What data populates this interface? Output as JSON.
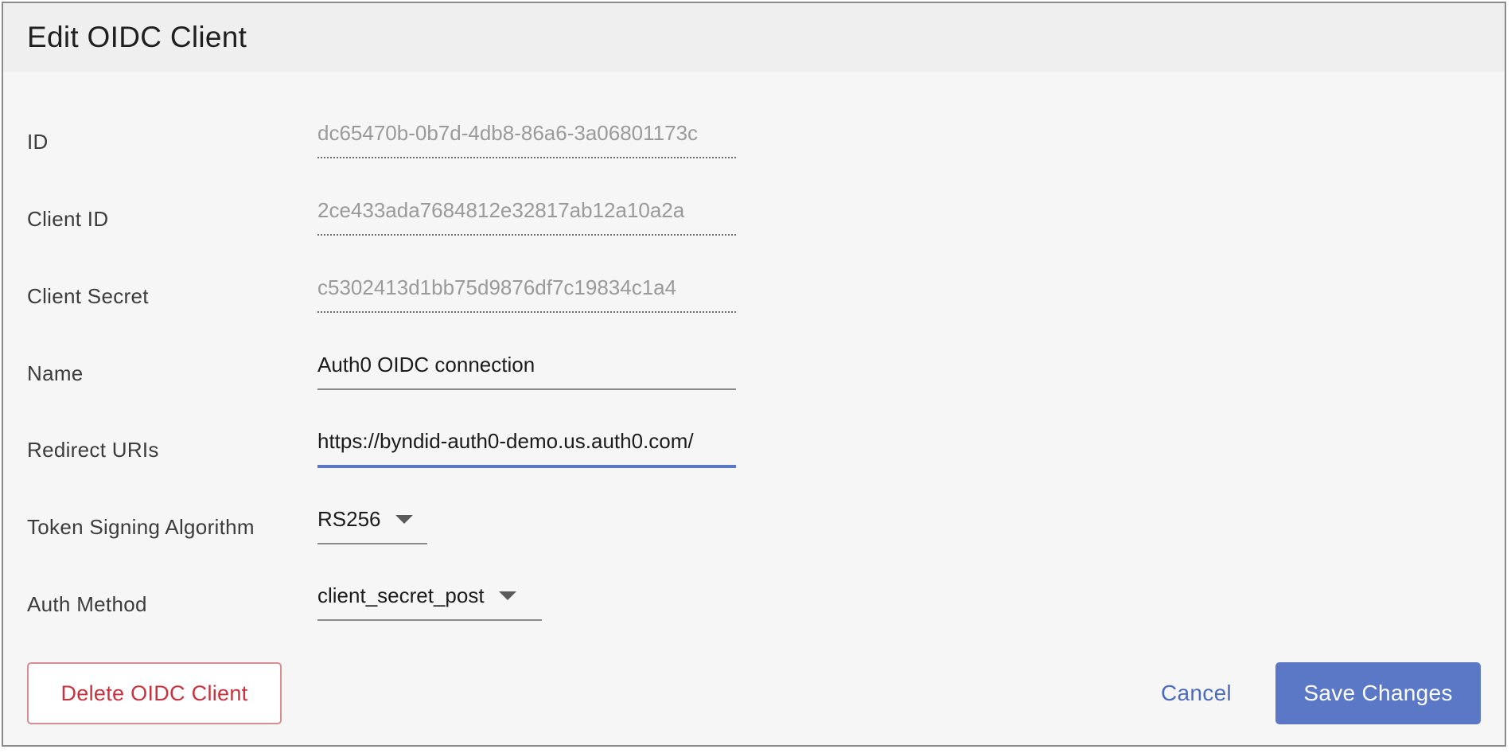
{
  "dialog": {
    "title": "Edit OIDC Client"
  },
  "fields": {
    "id": {
      "label": "ID",
      "value": "dc65470b-0b7d-4db8-86a6-3a06801173c"
    },
    "client_id": {
      "label": "Client ID",
      "value": "2ce433ada7684812e32817ab12a10a2a"
    },
    "client_secret": {
      "label": "Client Secret",
      "value": "c5302413d1bb75d9876df7c19834c1a4"
    },
    "name": {
      "label": "Name",
      "value": "Auth0 OIDC connection"
    },
    "redirect_uris": {
      "label": "Redirect URIs",
      "value": "https://byndid-auth0-demo.us.auth0.com/"
    },
    "token_signing_algorithm": {
      "label": "Token Signing Algorithm",
      "value": "RS256"
    },
    "auth_method": {
      "label": "Auth Method",
      "value": "client_secret_post"
    }
  },
  "actions": {
    "delete_label": "Delete OIDC Client",
    "cancel_label": "Cancel",
    "save_label": "Save Changes"
  },
  "colors": {
    "accent": "#5b78c7",
    "danger": "#c8323f",
    "background": "#f6f6f6",
    "header_background": "#efefef"
  }
}
